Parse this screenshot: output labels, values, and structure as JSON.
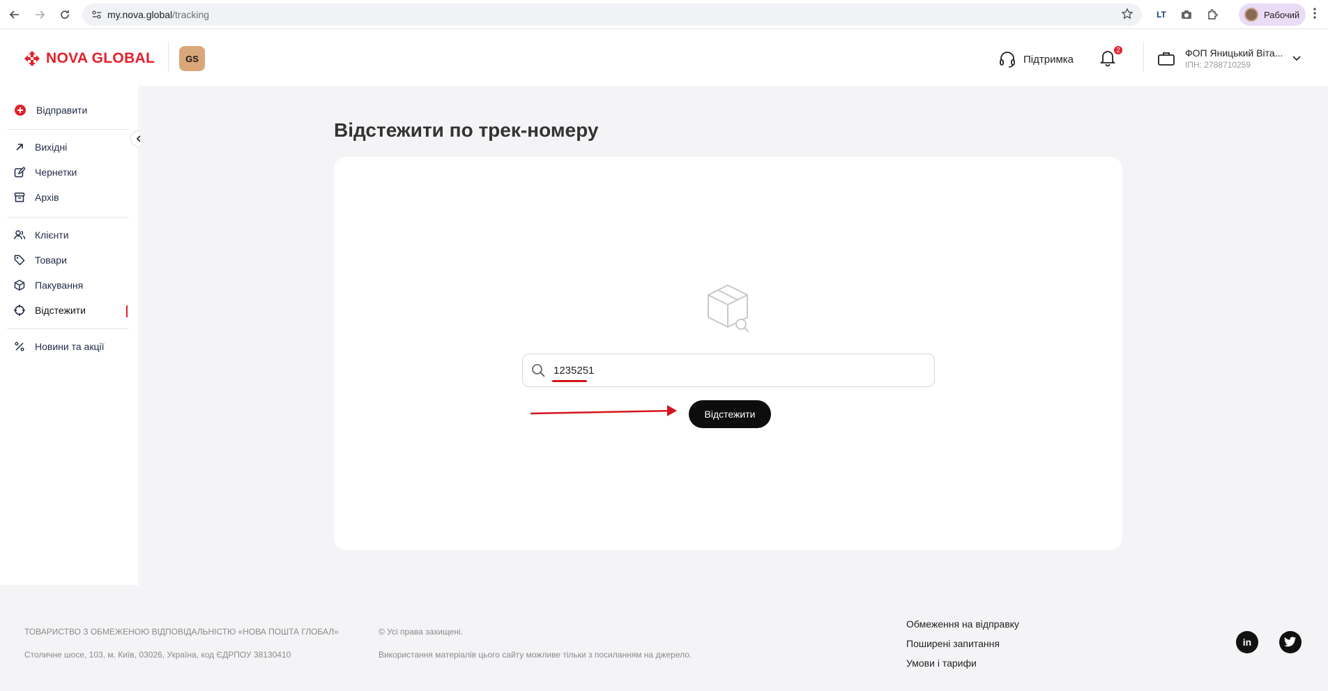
{
  "browser": {
    "url_host": "my.nova.global",
    "url_path": "/tracking",
    "profile_label": "Рабочий",
    "ext_label": "LT"
  },
  "header": {
    "logo_text": "NOVA GLOBAL",
    "gs_badge": "GS",
    "support_label": "Підтримка",
    "notification_count": "2",
    "account_name": "ФОП Яницький Віта...",
    "account_ipn": "ІПН: 2788710259"
  },
  "sidebar": {
    "items": [
      {
        "label": "Відправити",
        "icon": "plus-circle-icon"
      },
      {
        "label": "Вихідні",
        "icon": "arrow-up-right-icon"
      },
      {
        "label": "Чернетки",
        "icon": "edit-icon"
      },
      {
        "label": "Архів",
        "icon": "archive-icon"
      },
      {
        "label": "Клієнти",
        "icon": "users-icon"
      },
      {
        "label": "Товари",
        "icon": "tag-icon"
      },
      {
        "label": "Пакування",
        "icon": "package-icon"
      },
      {
        "label": "Відстежити",
        "icon": "target-icon"
      },
      {
        "label": "Новини та акції",
        "icon": "percent-icon"
      }
    ]
  },
  "main": {
    "title": "Відстежити по трек-номеру",
    "search_value": "1235251",
    "track_button": "Відстежити"
  },
  "footer": {
    "company": "ТОВАРИСТВО З ОБМЕЖЕНОЮ ВІДПОВІДАЛЬНІСТЮ «НОВА ПОШТА ГЛОБАЛ»",
    "address": "Столичне шосе, 103, м. Київ, 03026, Україна, код ЄДРПОУ 38130410",
    "rights": "© Усі права захищені.",
    "usage": "Використання матеріалів цього сайту можливе тільки з посиланням на джерело.",
    "links": [
      "Обмеження на відправку",
      "Поширені запитання",
      "Умови і тарифи"
    ],
    "social_linkedin": "in"
  },
  "colors": {
    "accent": "#e3202a",
    "button": "#0d0d0d",
    "background": "#f4f4f6"
  }
}
